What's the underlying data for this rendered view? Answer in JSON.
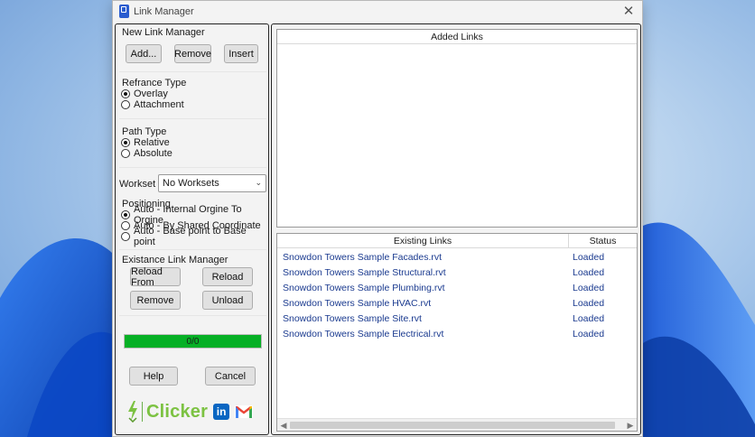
{
  "window": {
    "title": "Link Manager",
    "close_glyph": "✕"
  },
  "left": {
    "new_link": {
      "label": "New Link Manager",
      "add": "Add...",
      "remove": "Remove",
      "insert": "Insert"
    },
    "reference_type": {
      "label": "Refrance Type",
      "options": [
        "Overlay",
        "Attachment"
      ],
      "selected": 0
    },
    "path_type": {
      "label": "Path Type",
      "options": [
        "Relative",
        "Absolute"
      ],
      "selected": 0
    },
    "workset": {
      "label": "Workset",
      "value": "No Worksets"
    },
    "positioning": {
      "label": "Positioning",
      "options": [
        "Auto - Internal Orgine To Orgine",
        "Auto - By Shared Coordinate",
        "Auto - Base point to Base point"
      ],
      "selected": 0
    },
    "existing": {
      "label": "Existance Link Manager",
      "reload_from": "Reload From",
      "reload": "Reload",
      "remove": "Remove",
      "unload": "Unload"
    },
    "progress": {
      "text": "0/0",
      "fraction": 1.0
    },
    "help": "Help",
    "cancel": "Cancel",
    "brand": {
      "text": "Clicker",
      "linkedin_glyph": "in"
    }
  },
  "right": {
    "added_links": {
      "header": "Added Links",
      "rows": []
    },
    "existing_links": {
      "columns": [
        "Existing Links",
        "Status"
      ],
      "rows": [
        {
          "name": "Snowdon Towers Sample Facades.rvt",
          "status": "Loaded"
        },
        {
          "name": "Snowdon Towers Sample Structural.rvt",
          "status": "Loaded"
        },
        {
          "name": "Snowdon Towers Sample Plumbing.rvt",
          "status": "Loaded"
        },
        {
          "name": "Snowdon Towers Sample HVAC.rvt",
          "status": "Loaded"
        },
        {
          "name": "Snowdon Towers Sample Site.rvt",
          "status": "Loaded"
        },
        {
          "name": "Snowdon Towers Sample Electrical.rvt",
          "status": "Loaded"
        }
      ]
    }
  },
  "colors": {
    "progress": "#06b025",
    "link_text": "#1a3a8f",
    "brand_green": "#7cc242",
    "linkedin": "#0a66c2"
  }
}
